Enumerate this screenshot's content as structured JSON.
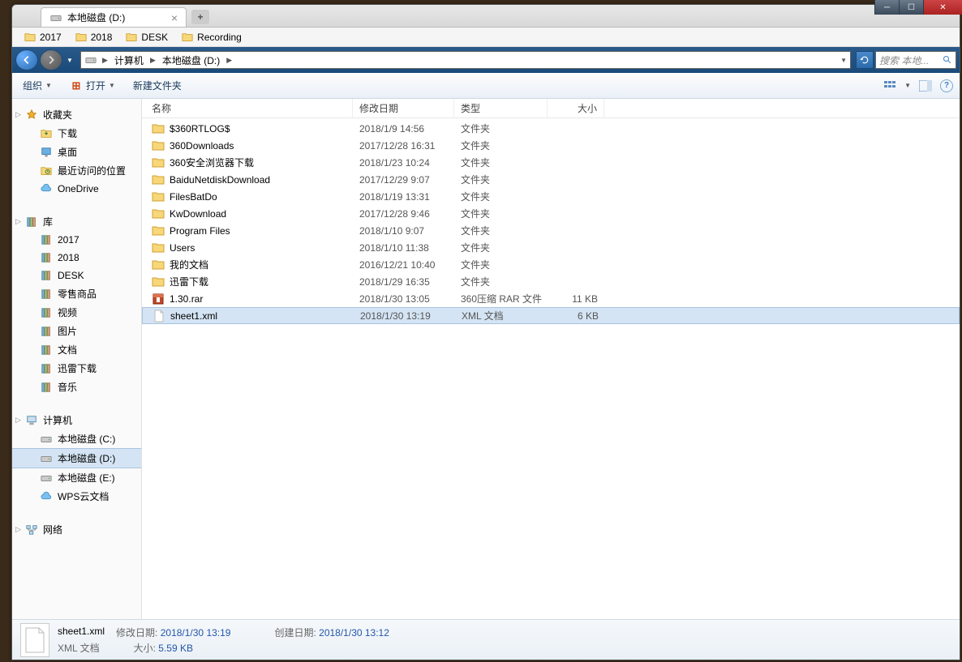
{
  "tab": {
    "title": "本地磁盘 (D:)"
  },
  "bookmarks": [
    {
      "label": "2017"
    },
    {
      "label": "2018"
    },
    {
      "label": "DESK"
    },
    {
      "label": "Recording"
    }
  ],
  "breadcrumb": {
    "seg1": "计算机",
    "seg2": "本地磁盘 (D:)"
  },
  "search": {
    "placeholder": "搜索 本地..."
  },
  "toolbar": {
    "organize": "组织",
    "open": "打开",
    "newfolder": "新建文件夹"
  },
  "sidebar": {
    "favorites": {
      "title": "收藏夹",
      "items": [
        "下载",
        "桌面",
        "最近访问的位置",
        "OneDrive"
      ]
    },
    "libraries": {
      "title": "库",
      "items": [
        "2017",
        "2018",
        "DESK",
        "零售商品",
        "视频",
        "图片",
        "文档",
        "迅雷下载",
        "音乐"
      ]
    },
    "computer": {
      "title": "计算机",
      "items": [
        "本地磁盘 (C:)",
        "本地磁盘 (D:)",
        "本地磁盘 (E:)",
        "WPS云文档"
      ]
    },
    "network": {
      "title": "网络"
    }
  },
  "columns": {
    "name": "名称",
    "date": "修改日期",
    "type": "类型",
    "size": "大小"
  },
  "files": [
    {
      "name": "$360RTLOG$",
      "date": "2018/1/9 14:56",
      "type": "文件夹",
      "size": "",
      "icon": "folder"
    },
    {
      "name": "360Downloads",
      "date": "2017/12/28 16:31",
      "type": "文件夹",
      "size": "",
      "icon": "folder"
    },
    {
      "name": "360安全浏览器下载",
      "date": "2018/1/23 10:24",
      "type": "文件夹",
      "size": "",
      "icon": "folder"
    },
    {
      "name": "BaiduNetdiskDownload",
      "date": "2017/12/29 9:07",
      "type": "文件夹",
      "size": "",
      "icon": "folder"
    },
    {
      "name": "FilesBatDo",
      "date": "2018/1/19 13:31",
      "type": "文件夹",
      "size": "",
      "icon": "folder"
    },
    {
      "name": "KwDownload",
      "date": "2017/12/28 9:46",
      "type": "文件夹",
      "size": "",
      "icon": "folder"
    },
    {
      "name": "Program Files",
      "date": "2018/1/10 9:07",
      "type": "文件夹",
      "size": "",
      "icon": "folder"
    },
    {
      "name": "Users",
      "date": "2018/1/10 11:38",
      "type": "文件夹",
      "size": "",
      "icon": "folder"
    },
    {
      "name": "我的文档",
      "date": "2016/12/21 10:40",
      "type": "文件夹",
      "size": "",
      "icon": "folder"
    },
    {
      "name": "迅雷下载",
      "date": "2018/1/29 16:35",
      "type": "文件夹",
      "size": "",
      "icon": "folder"
    },
    {
      "name": "1.30.rar",
      "date": "2018/1/30 13:05",
      "type": "360压缩 RAR 文件",
      "size": "11 KB",
      "icon": "rar"
    },
    {
      "name": "sheet1.xml",
      "date": "2018/1/30 13:19",
      "type": "XML 文档",
      "size": "6 KB",
      "icon": "file",
      "selected": true
    }
  ],
  "details": {
    "filename": "sheet1.xml",
    "filetype": "XML 文档",
    "modLabel": "修改日期:",
    "modValue": "2018/1/30 13:19",
    "sizeLabel": "大小:",
    "sizeValue": "5.59 KB",
    "createdLabel": "创建日期:",
    "createdValue": "2018/1/30 13:12"
  }
}
